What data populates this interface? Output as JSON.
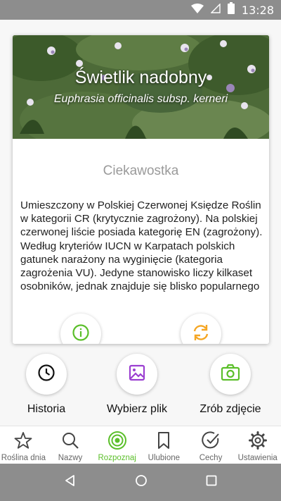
{
  "status_bar": {
    "time": "13:28",
    "icons": [
      "wifi-icon",
      "no-signal-icon",
      "battery-icon"
    ]
  },
  "card": {
    "title": "Świetlik nadobny",
    "latin_name": "Euphrasia officinalis subsp. kerneri",
    "section_title": "Ciekawostka",
    "fact": "Umieszczony w Polskiej Czerwonej Księdze Roślin w kategorii CR (krytycznie zagrożony). Na polskiej czerwonej liście posiada kategorię EN (zagrożony).  Według kryteriów IUCN w Karpatach polskich gatunek narażony na wyginięcie (kategoria zagrożenia VU). Jedyne stanowisko liczy kilkaset osobników, jednak znajduje się blisko popularnego szlaku turystycznego na",
    "buttons": [
      "info-icon",
      "refresh-icon"
    ]
  },
  "actions": [
    {
      "label": "Historia",
      "icon": "clock-icon"
    },
    {
      "label": "Wybierz plik",
      "icon": "image-icon"
    },
    {
      "label": "Zrób zdjęcie",
      "icon": "camera-icon"
    }
  ],
  "bottom_nav": [
    {
      "label": "Roślina dnia",
      "icon": "star-icon",
      "active": false
    },
    {
      "label": "Nazwy",
      "icon": "search-icon",
      "active": false
    },
    {
      "label": "Rozpoznaj",
      "icon": "target-icon",
      "active": true
    },
    {
      "label": "Ulubione",
      "icon": "bookmark-icon",
      "active": false
    },
    {
      "label": "Cechy",
      "icon": "check-circle-icon",
      "active": false
    },
    {
      "label": "Ustawienia",
      "icon": "gear-icon",
      "active": false
    }
  ],
  "colors": {
    "accent_green": "#5bbf2a",
    "accent_orange": "#f5a623",
    "accent_purple": "#9b3fd1",
    "status_bar": "#8d8d8d"
  }
}
